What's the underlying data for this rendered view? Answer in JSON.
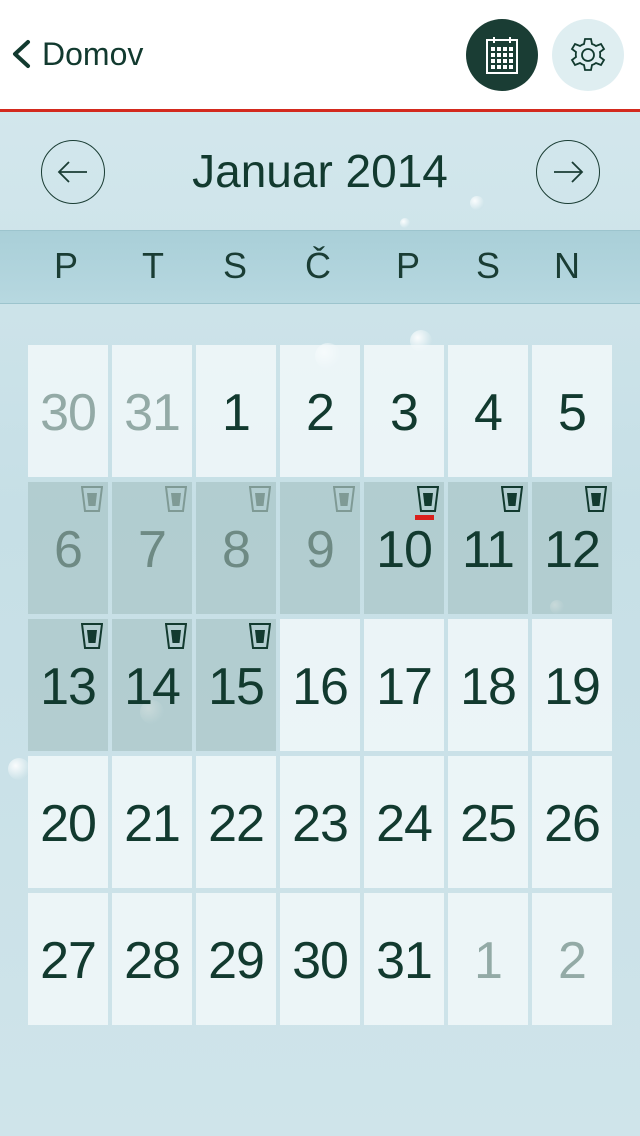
{
  "header": {
    "back_label": "Domov",
    "calendar_icon": "calendar-icon",
    "settings_icon": "gear-icon"
  },
  "month": {
    "title": "Januar 2014",
    "prev_icon": "arrow-left-icon",
    "next_icon": "arrow-right-icon"
  },
  "weekdays": [
    "P",
    "T",
    "S",
    "Č",
    "P",
    "S",
    "N"
  ],
  "days": [
    {
      "label": "30",
      "other": true
    },
    {
      "label": "31",
      "other": true
    },
    {
      "label": "1"
    },
    {
      "label": "2"
    },
    {
      "label": "3"
    },
    {
      "label": "4"
    },
    {
      "label": "5"
    },
    {
      "label": "6",
      "drunk": true,
      "past": true,
      "cup": "faded"
    },
    {
      "label": "7",
      "drunk": true,
      "past": true,
      "cup": "faded"
    },
    {
      "label": "8",
      "drunk": true,
      "past": true,
      "cup": "faded"
    },
    {
      "label": "9",
      "drunk": true,
      "past": true,
      "cup": "faded"
    },
    {
      "label": "10",
      "drunk": true,
      "cup": "full",
      "today": true
    },
    {
      "label": "11",
      "drunk": true,
      "cup": "full"
    },
    {
      "label": "12",
      "drunk": true,
      "cup": "full"
    },
    {
      "label": "13",
      "drunk": true,
      "cup": "full"
    },
    {
      "label": "14",
      "drunk": true,
      "cup": "full"
    },
    {
      "label": "15",
      "drunk": true,
      "cup": "full"
    },
    {
      "label": "16"
    },
    {
      "label": "17"
    },
    {
      "label": "18"
    },
    {
      "label": "19"
    },
    {
      "label": "20"
    },
    {
      "label": "21"
    },
    {
      "label": "22"
    },
    {
      "label": "23"
    },
    {
      "label": "24"
    },
    {
      "label": "25"
    },
    {
      "label": "26"
    },
    {
      "label": "27"
    },
    {
      "label": "28"
    },
    {
      "label": "29"
    },
    {
      "label": "30"
    },
    {
      "label": "31"
    },
    {
      "label": "1",
      "other": true
    },
    {
      "label": "2",
      "other": true
    }
  ],
  "colors": {
    "accent": "#d32a1e",
    "dark": "#1a3d34",
    "today_marker": "#d9201c"
  }
}
